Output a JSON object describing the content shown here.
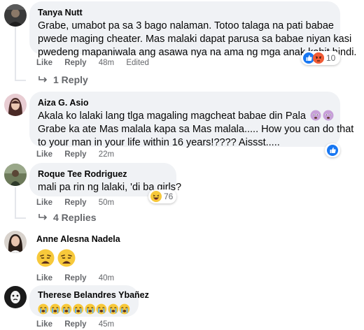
{
  "comments": [
    {
      "name": "Tanya Nutt",
      "lines": [
        "Grabe, umabot pa sa 3 bago nalaman. Totoo talaga na pati babae",
        "pwede maging cheater. Mas malaki dapat parusa sa babae niyan kasi",
        "pwedeng mapaniwala ang asawa nya na ama ng mga anak kahit hindi."
      ],
      "actions": {
        "like": "Like",
        "reply": "Reply",
        "time": "48m",
        "edited": "Edited"
      },
      "reactions": {
        "icons": [
          "like-reaction-icon",
          "angry-reaction-icon"
        ],
        "count": "10"
      },
      "replies": "1 Reply"
    },
    {
      "name": "Aiza G. Asio",
      "lines": [
        "Akala ko lalaki lang tlga magaling magcheat babae din Pala",
        "Grabe ka ate Mas malala kapa sa Mas malala..... How you can do that",
        "to your man in your life within 16 years!???? Aissst....."
      ],
      "emoji": [
        "anxious-face-emoji",
        "anxious-face-emoji"
      ],
      "actions": {
        "like": "Like",
        "reply": "Reply",
        "time": "22m"
      },
      "reactions": {
        "icons": [
          "like-reaction-icon"
        ],
        "count": ""
      }
    },
    {
      "name": "Roque Tee Rodriguez",
      "lines": [
        "mali pa rin ng lalaki, 'di ba girls?"
      ],
      "actions": {
        "like": "Like",
        "reply": "Reply",
        "time": "50m"
      },
      "reactions": {
        "icons": [
          "haha-reaction-icon"
        ],
        "count": "76"
      },
      "replies": "4 Replies"
    },
    {
      "name": "Anne Alesna Nadela",
      "emoji": [
        "weary-face-emoji",
        "weary-face-emoji"
      ],
      "actions": {
        "like": "Like",
        "reply": "Reply",
        "time": "40m"
      }
    },
    {
      "name": "Therese Belandres Ybañez",
      "emoji": [
        "crying-face-emoji",
        "crying-face-emoji",
        "crying-face-emoji",
        "crying-face-emoji",
        "crying-face-emoji",
        "crying-face-emoji",
        "crying-face-emoji",
        "crying-face-emoji"
      ],
      "actions": {
        "like": "Like",
        "reply": "Reply",
        "time": "45m"
      }
    }
  ],
  "colors": {
    "bubble": "#f0f2f5",
    "meta": "#65676b",
    "like_blue": "#1877f2",
    "angry": "#f15b35"
  }
}
